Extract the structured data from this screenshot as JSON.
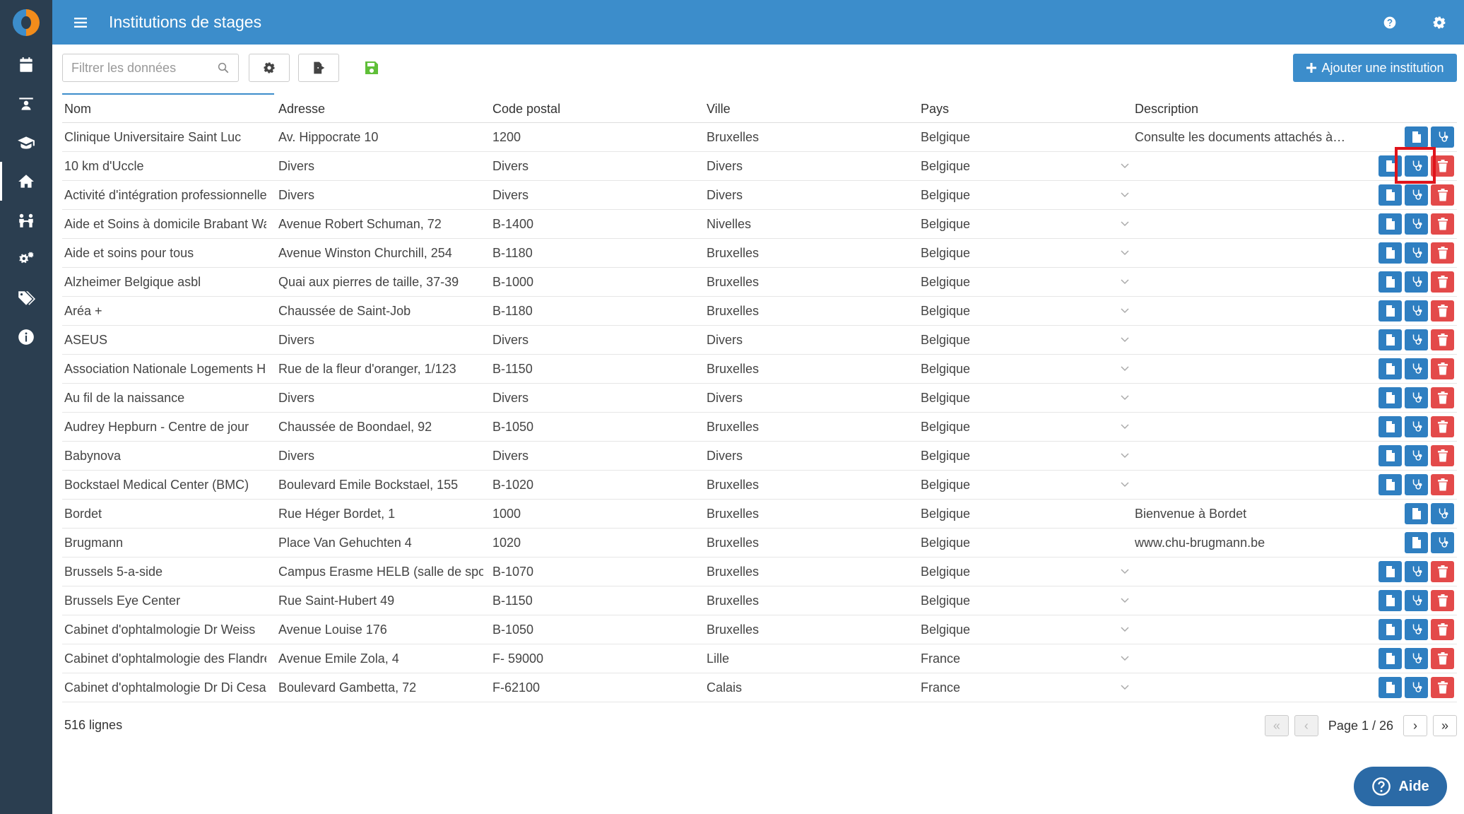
{
  "header": {
    "title": "Institutions de stages"
  },
  "toolbar": {
    "search_placeholder": "Filtrer les données",
    "add_label": "Ajouter une institution"
  },
  "columns": [
    "Nom",
    "Adresse",
    "Code postal",
    "Ville",
    "Pays",
    "Description"
  ],
  "rows": [
    {
      "nom": "Clinique Universitaire Saint Luc",
      "adresse": "Av. Hippocrate 10",
      "cp": "1200",
      "ville": "Bruxelles",
      "pays": "Belgique",
      "description": "Consulte les documents attachés à l...",
      "deletable": false
    },
    {
      "nom": "10 km d'Uccle",
      "adresse": "Divers",
      "cp": "Divers",
      "ville": "Divers",
      "pays": "Belgique",
      "description": "",
      "deletable": true
    },
    {
      "nom": "Activité d'intégration professionnelle",
      "adresse": "Divers",
      "cp": "Divers",
      "ville": "Divers",
      "pays": "Belgique",
      "description": "",
      "deletable": true
    },
    {
      "nom": "Aide et Soins à domicile Brabant Wallon",
      "adresse": "Avenue Robert Schuman, 72",
      "cp": "B-1400",
      "ville": "Nivelles",
      "pays": "Belgique",
      "description": "",
      "deletable": true
    },
    {
      "nom": "Aide et soins pour tous",
      "adresse": "Avenue Winston Churchill, 254",
      "cp": "B-1180",
      "ville": "Bruxelles",
      "pays": "Belgique",
      "description": "",
      "deletable": true
    },
    {
      "nom": "Alzheimer Belgique asbl",
      "adresse": "Quai aux pierres de taille, 37-39",
      "cp": "B-1000",
      "ville": "Bruxelles",
      "pays": "Belgique",
      "description": "",
      "deletable": true
    },
    {
      "nom": "Aréa +",
      "adresse": "Chaussée de Saint-Job",
      "cp": "B-1180",
      "ville": "Bruxelles",
      "pays": "Belgique",
      "description": "",
      "deletable": true
    },
    {
      "nom": "ASEUS",
      "adresse": "Divers",
      "cp": "Divers",
      "ville": "Divers",
      "pays": "Belgique",
      "description": "",
      "deletable": true
    },
    {
      "nom": "Association Nationale Logements Handicapés",
      "adresse": "Rue de la fleur d'oranger, 1/123",
      "cp": "B-1150",
      "ville": "Bruxelles",
      "pays": "Belgique",
      "description": "",
      "deletable": true
    },
    {
      "nom": "Au fil de la naissance",
      "adresse": "Divers",
      "cp": "Divers",
      "ville": "Divers",
      "pays": "Belgique",
      "description": "",
      "deletable": true
    },
    {
      "nom": "Audrey Hepburn - Centre de jour",
      "adresse": "Chaussée de Boondael, 92",
      "cp": "B-1050",
      "ville": "Bruxelles",
      "pays": "Belgique",
      "description": "",
      "deletable": true
    },
    {
      "nom": "Babynova",
      "adresse": "Divers",
      "cp": "Divers",
      "ville": "Divers",
      "pays": "Belgique",
      "description": "",
      "deletable": true
    },
    {
      "nom": "Bockstael Medical Center (BMC)",
      "adresse": "Boulevard Emile Bockstael, 155",
      "cp": "B-1020",
      "ville": "Bruxelles",
      "pays": "Belgique",
      "description": "",
      "deletable": true
    },
    {
      "nom": "Bordet",
      "adresse": "Rue Héger Bordet, 1",
      "cp": "1000",
      "ville": "Bruxelles",
      "pays": "Belgique",
      "description": "Bienvenue à Bordet",
      "deletable": false
    },
    {
      "nom": "Brugmann",
      "adresse": "Place Van Gehuchten 4",
      "cp": "1020",
      "ville": "Bruxelles",
      "pays": "Belgique",
      "description": "www.chu-brugmann.be",
      "deletable": false
    },
    {
      "nom": "Brussels 5-a-side",
      "adresse": "Campus Erasme HELB (salle de sport)",
      "cp": "B-1070",
      "ville": "Bruxelles",
      "pays": "Belgique",
      "description": "",
      "deletable": true
    },
    {
      "nom": "Brussels Eye Center",
      "adresse": "Rue Saint-Hubert 49",
      "cp": "B-1150",
      "ville": "Bruxelles",
      "pays": "Belgique",
      "description": "",
      "deletable": true
    },
    {
      "nom": "Cabinet d'ophtalmologie  Dr Weiss",
      "adresse": "Avenue Louise 176",
      "cp": "B-1050",
      "ville": "Bruxelles",
      "pays": "Belgique",
      "description": "",
      "deletable": true
    },
    {
      "nom": "Cabinet d'ophtalmologie des Flandres",
      "adresse": "Avenue Emile Zola, 4",
      "cp": "F- 59000",
      "ville": "Lille",
      "pays": "France",
      "description": "",
      "deletable": true
    },
    {
      "nom": "Cabinet d'ophtalmologie Dr Di Cesare",
      "adresse": "Boulevard Gambetta, 72",
      "cp": "F-62100",
      "ville": "Calais",
      "pays": "France",
      "description": "",
      "deletable": true
    }
  ],
  "footer": {
    "count_label": "516 lignes",
    "page_label": "Page 1 / 26"
  },
  "help": {
    "label": "Aide"
  },
  "colors": {
    "topbar": "#3c8dcb",
    "sidebar": "#2b3e50",
    "action_blue": "#2f7fc1",
    "action_red": "#e34a4a",
    "highlight": "#e0141b"
  }
}
